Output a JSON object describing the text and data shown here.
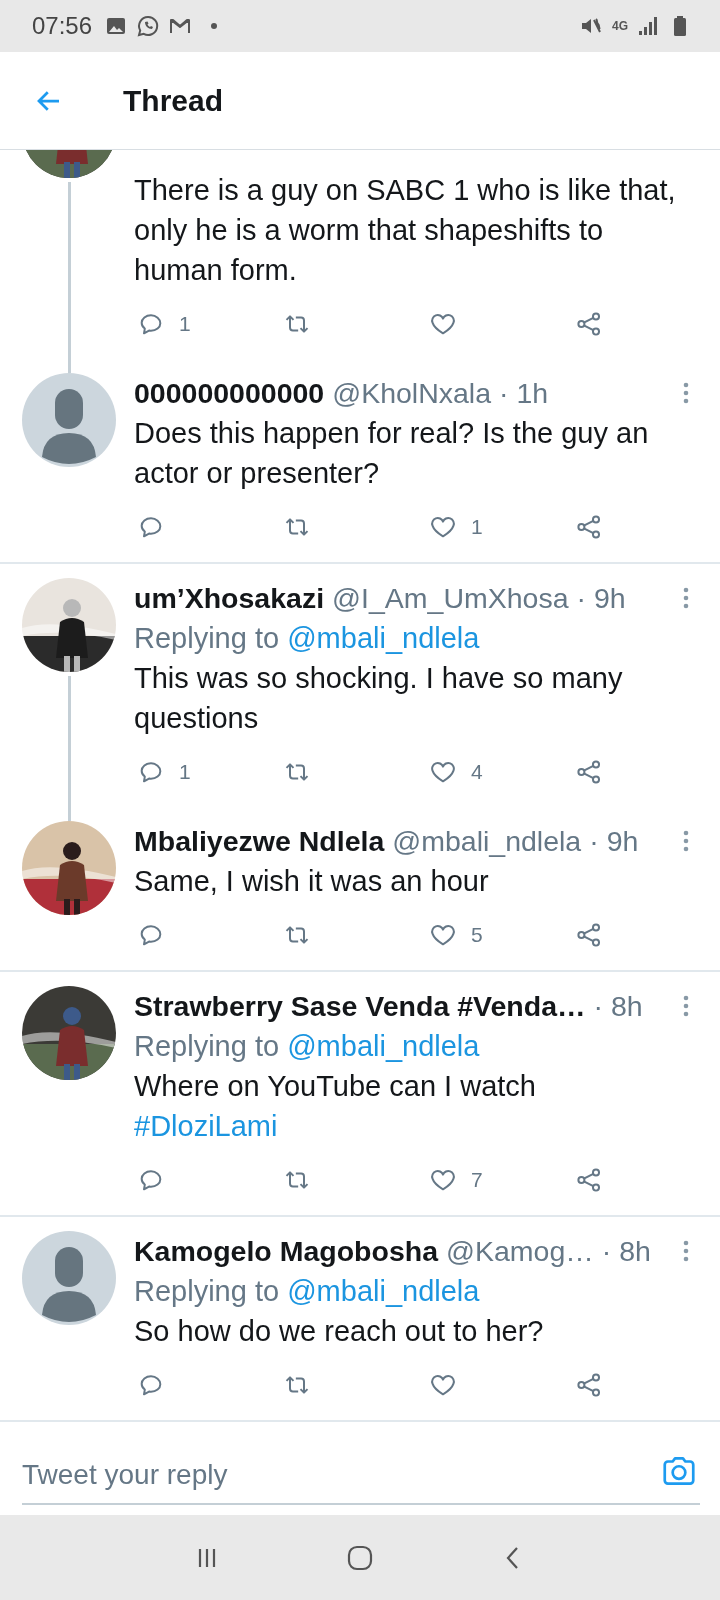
{
  "status_bar": {
    "time": "07:56",
    "network": "4G"
  },
  "header": {
    "title": "Thread"
  },
  "tweets": [
    {
      "avatar": {
        "kind": "picture"
      },
      "thread_line": true,
      "body": [
        {
          "kind": "plain",
          "text": "There is a guy on SABC 1 who is like that, only he is a worm that shapeshifts to human form."
        }
      ],
      "replies": "1"
    },
    {
      "avatar": {
        "kind": "default"
      },
      "thread_line": false,
      "name": "000000000000",
      "handle": "@KholNxala",
      "time": "· 1h",
      "body": [
        {
          "kind": "plain",
          "text": "Does this happen for real? Is the guy an actor or presenter?"
        }
      ],
      "likes": "1"
    },
    {
      "avatar": {
        "kind": "picture"
      },
      "thread_line": true,
      "name": "um’Xhosakazi",
      "handle": "@I_Am_UmXhosa",
      "time": "· 9h",
      "replying_label": "Replying to",
      "replying_to": "@mbali_ndlela",
      "body": [
        {
          "kind": "plain",
          "text": "This was so shocking. I have so many questions"
        }
      ],
      "replies": "1",
      "likes": "4"
    },
    {
      "avatar": {
        "kind": "picture"
      },
      "thread_line": false,
      "name": "Mbaliyezwe Ndlela",
      "handle": "@mbali_ndlela",
      "time": "· 9h",
      "body": [
        {
          "kind": "plain",
          "text": "Same, I wish it was an hour"
        }
      ],
      "likes": "5"
    },
    {
      "avatar": {
        "kind": "picture"
      },
      "thread_line": false,
      "name": "Strawberry Sase Venda #Venda…",
      "time": "· 8h",
      "replying_label": "Replying to",
      "replying_to": "@mbali_ndlela",
      "body": [
        {
          "kind": "plain",
          "text": "Where on YouTube can I watch "
        },
        {
          "kind": "hashtag",
          "text": "#DloziLami"
        }
      ],
      "likes": "7"
    },
    {
      "avatar": {
        "kind": "default"
      },
      "thread_line": false,
      "name": "Kamogelo Magobosha",
      "handle": "@Kamog…",
      "time": "· 8h",
      "replying_label": "Replying to",
      "replying_to": "@mbali_ndlela",
      "body": [
        {
          "kind": "plain",
          "text": "So how do we reach out to her?"
        }
      ]
    }
  ],
  "reply_bar": {
    "placeholder": "Tweet your reply"
  }
}
